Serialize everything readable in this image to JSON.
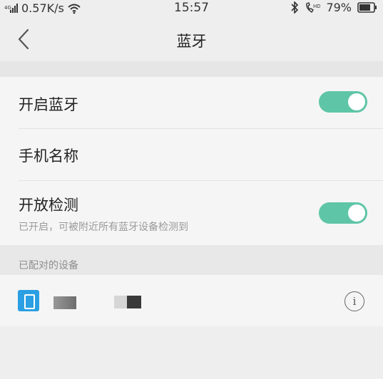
{
  "status_bar": {
    "network_speed": "0.57K/s",
    "time": "15:57",
    "battery_percent": "79%",
    "battery_level": 0.79,
    "icons": [
      "signal-icon",
      "wifi-icon",
      "bluetooth-icon",
      "call-icon",
      "battery-icon"
    ]
  },
  "header": {
    "title": "蓝牙",
    "back_icon": "chevron-left-icon"
  },
  "settings": {
    "bluetooth_toggle": {
      "label": "开启蓝牙",
      "enabled": true
    },
    "phone_name": {
      "label": "手机名称"
    },
    "visibility": {
      "label": "开放检测",
      "subtitle": "已开启，可被附近所有蓝牙设备检测到",
      "enabled": true
    }
  },
  "paired_devices": {
    "section_title": "已配对的设备",
    "devices": [
      {
        "icon": "phone-icon",
        "name_redacted": true
      }
    ],
    "info_icon": "info-icon"
  },
  "colors": {
    "toggle_on": "#5ec5a6",
    "device_icon_bg": "#2a9fe3",
    "background": "#eeeeee",
    "card": "#f5f5f5"
  }
}
